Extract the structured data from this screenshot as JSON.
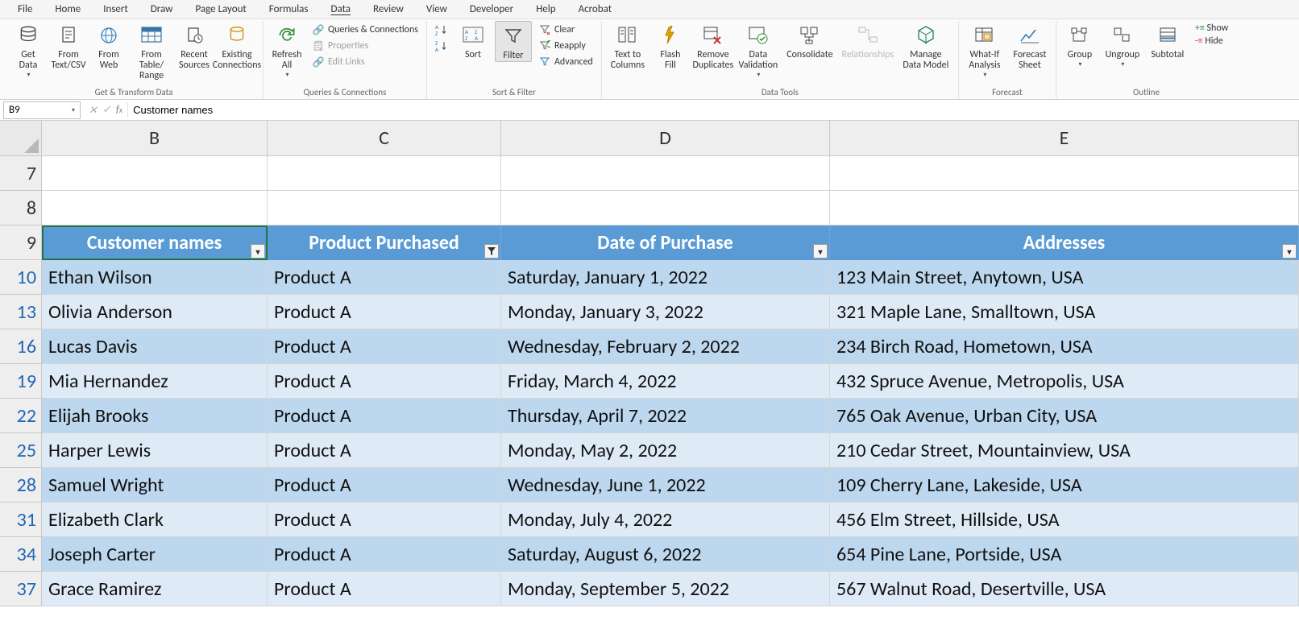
{
  "menu": {
    "items": [
      "File",
      "Home",
      "Insert",
      "Draw",
      "Page Layout",
      "Formulas",
      "Data",
      "Review",
      "View",
      "Developer",
      "Help",
      "Acrobat"
    ],
    "active_index": 6
  },
  "ribbon": {
    "get_transform": {
      "label": "Get & Transform Data",
      "buttons": {
        "get_data": "Get\nData",
        "from_text": "From\nText/CSV",
        "from_web": "From\nWeb",
        "from_table": "From Table/\nRange",
        "recent": "Recent\nSources",
        "existing": "Existing\nConnections"
      }
    },
    "queries": {
      "label": "Queries & Connections",
      "refresh": "Refresh\nAll",
      "qc": "Queries & Connections",
      "props": "Properties",
      "links": "Edit Links"
    },
    "sort_filter": {
      "label": "Sort & Filter",
      "sort": "Sort",
      "filter": "Filter",
      "clear": "Clear",
      "reapply": "Reapply",
      "advanced": "Advanced"
    },
    "data_tools": {
      "label": "Data Tools",
      "text_cols": "Text to\nColumns",
      "flash": "Flash\nFill",
      "remove_dup": "Remove\nDuplicates",
      "validation": "Data\nValidation",
      "consolidate": "Consolidate",
      "relationships": "Relationships",
      "data_model": "Manage\nData Model"
    },
    "forecast": {
      "label": "Forecast",
      "whatif": "What-If\nAnalysis",
      "forecast": "Forecast\nSheet"
    },
    "outline": {
      "label": "Outline",
      "group": "Group",
      "ungroup": "Ungroup",
      "subtotal": "Subtotal",
      "show_detail": "Show",
      "hide_detail": "Hide"
    }
  },
  "namebox": {
    "value": "B9"
  },
  "formula": {
    "value": "Customer names"
  },
  "columns": [
    "B",
    "C",
    "D",
    "E"
  ],
  "top_rows": [
    "7",
    "8"
  ],
  "table": {
    "header_row": "9",
    "headers": [
      "Customer names",
      "Product Purchased",
      "Date of Purchase",
      "Addresses"
    ],
    "filter_icons": [
      "dropdown",
      "filtered",
      "dropdown",
      "dropdown"
    ],
    "rows": [
      {
        "n": "10",
        "name": "Ethan Wilson",
        "prod": "Product A",
        "date": "Saturday, January 1, 2022",
        "addr": "123 Main Street, Anytown, USA"
      },
      {
        "n": "13",
        "name": "Olivia Anderson",
        "prod": "Product A",
        "date": "Monday, January 3, 2022",
        "addr": "321 Maple Lane, Smalltown, USA"
      },
      {
        "n": "16",
        "name": "Lucas Davis",
        "prod": "Product A",
        "date": "Wednesday, February 2, 2022",
        "addr": "234 Birch Road, Hometown, USA"
      },
      {
        "n": "19",
        "name": "Mia Hernandez",
        "prod": "Product A",
        "date": "Friday, March 4, 2022",
        "addr": "432 Spruce Avenue, Metropolis, USA"
      },
      {
        "n": "22",
        "name": "Elijah Brooks",
        "prod": "Product A",
        "date": "Thursday, April 7, 2022",
        "addr": "765 Oak Avenue, Urban City, USA"
      },
      {
        "n": "25",
        "name": "Harper Lewis",
        "prod": "Product A",
        "date": "Monday, May 2, 2022",
        "addr": "210 Cedar Street, Mountainview, USA"
      },
      {
        "n": "28",
        "name": "Samuel Wright",
        "prod": "Product A",
        "date": "Wednesday, June 1, 2022",
        "addr": "109 Cherry Lane, Lakeside, USA"
      },
      {
        "n": "31",
        "name": "Elizabeth Clark",
        "prod": "Product A",
        "date": "Monday, July 4, 2022",
        "addr": "456 Elm Street, Hillside, USA"
      },
      {
        "n": "34",
        "name": "Joseph Carter",
        "prod": "Product A",
        "date": "Saturday, August 6, 2022",
        "addr": "654 Pine Lane, Portside, USA"
      },
      {
        "n": "37",
        "name": "Grace Ramirez",
        "prod": "Product A",
        "date": "Monday, September 5, 2022",
        "addr": "567 Walnut Road, Desertville, USA"
      }
    ]
  }
}
